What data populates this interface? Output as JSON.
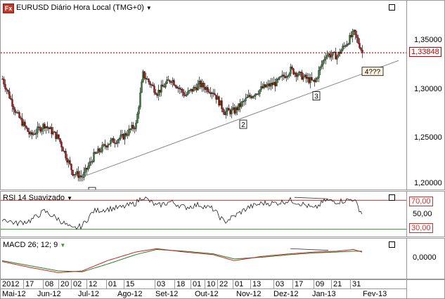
{
  "header": {
    "logo_text": "Fx",
    "title": "EURUSD Diário Hora Local (TMG+0)",
    "dropdown_icon": "triangle-down-icon"
  },
  "price_panel": {
    "current_price_label": "1,33848",
    "y_ticks": [
      "1,35000",
      "1,30000",
      "1,25000",
      "1,20000"
    ],
    "annotations": [
      "1",
      "2",
      "3",
      "4???"
    ]
  },
  "rsi_panel": {
    "title": "RSI 14 Suavizado",
    "levels": [
      "70,00",
      "50,00",
      "30,00"
    ]
  },
  "macd_panel": {
    "title": "MACD 26; 12; 9",
    "y_ticks": [
      "0,0000"
    ]
  },
  "x_axis": {
    "day_labels": [
      "2012",
      "17",
      "08",
      "20",
      "02",
      "12",
      "01",
      "15",
      "03",
      "18",
      "01",
      "10",
      "22",
      "01",
      "13",
      "03",
      "17",
      "09",
      "21",
      "31"
    ],
    "month_labels": [
      "Mai-12",
      "Jun-12",
      "Jul-12",
      "Ago-12",
      "Set-12",
      "Out-12",
      "Nov-12",
      "Dez-12",
      "Jan-13",
      "Fev-13"
    ]
  },
  "colors": {
    "bull": "#2b7a2b",
    "bear": "#b00000",
    "rsi_upper": "#d03030",
    "rsi_lower": "#2a9a2a",
    "price_line": "#c00000",
    "macd_fast": "#cc2020",
    "macd_slow": "#208020"
  },
  "chart_data": {
    "type": "candlestick",
    "price": {
      "ylim": [
        1.19,
        1.38
      ],
      "current": 1.33848,
      "anchors": [
        [
          0,
          1.31
        ],
        [
          10,
          1.272
        ],
        [
          20,
          1.248
        ],
        [
          30,
          1.26
        ],
        [
          40,
          1.245
        ],
        [
          50,
          1.208
        ],
        [
          57,
          1.203
        ],
        [
          65,
          1.226
        ],
        [
          75,
          1.24
        ],
        [
          85,
          1.246
        ],
        [
          95,
          1.26
        ],
        [
          100,
          1.315
        ],
        [
          110,
          1.295
        ],
        [
          120,
          1.31
        ],
        [
          130,
          1.292
        ],
        [
          140,
          1.304
        ],
        [
          150,
          1.296
        ],
        [
          158,
          1.274
        ],
        [
          165,
          1.275
        ],
        [
          175,
          1.29
        ],
        [
          185,
          1.3
        ],
        [
          195,
          1.306
        ],
        [
          205,
          1.32
        ],
        [
          215,
          1.311
        ],
        [
          222,
          1.306
        ],
        [
          230,
          1.337
        ],
        [
          238,
          1.335
        ],
        [
          245,
          1.35
        ],
        [
          250,
          1.36
        ],
        [
          254,
          1.347
        ],
        [
          256,
          1.3385
        ]
      ],
      "count": 257,
      "trendline": {
        "from": [
          57,
          1.203
        ],
        "to": [
          282,
          1.33
        ]
      }
    },
    "rsi": {
      "ylim": [
        20,
        80
      ],
      "levels": [
        70,
        50,
        30
      ],
      "anchors": [
        [
          0,
          45
        ],
        [
          10,
          38
        ],
        [
          20,
          42
        ],
        [
          30,
          55
        ],
        [
          40,
          44
        ],
        [
          50,
          30
        ],
        [
          57,
          35
        ],
        [
          65,
          55
        ],
        [
          75,
          58
        ],
        [
          85,
          60
        ],
        [
          95,
          66
        ],
        [
          100,
          75
        ],
        [
          110,
          62
        ],
        [
          120,
          68
        ],
        [
          130,
          60
        ],
        [
          140,
          64
        ],
        [
          150,
          58
        ],
        [
          158,
          40
        ],
        [
          165,
          48
        ],
        [
          175,
          60
        ],
        [
          185,
          66
        ],
        [
          195,
          66
        ],
        [
          205,
          70
        ],
        [
          215,
          64
        ],
        [
          222,
          58
        ],
        [
          230,
          70
        ],
        [
          238,
          68
        ],
        [
          245,
          70
        ],
        [
          250,
          72
        ],
        [
          254,
          58
        ],
        [
          256,
          52
        ]
      ]
    },
    "macd": {
      "ylim": [
        -0.025,
        0.02
      ],
      "fast": [
        [
          0,
          -0.005
        ],
        [
          20,
          -0.012
        ],
        [
          40,
          -0.018
        ],
        [
          57,
          -0.016
        ],
        [
          75,
          -0.004
        ],
        [
          95,
          0.006
        ],
        [
          110,
          0.01
        ],
        [
          130,
          0.006
        ],
        [
          150,
          0.003
        ],
        [
          165,
          -0.004
        ],
        [
          185,
          0.001
        ],
        [
          205,
          0.004
        ],
        [
          222,
          0.006
        ],
        [
          238,
          0.007
        ],
        [
          250,
          0.009
        ],
        [
          256,
          0.006
        ]
      ],
      "slow": [
        [
          0,
          -0.004
        ],
        [
          20,
          -0.01
        ],
        [
          40,
          -0.016
        ],
        [
          57,
          -0.017
        ],
        [
          75,
          -0.008
        ],
        [
          95,
          0.003
        ],
        [
          110,
          0.009
        ],
        [
          130,
          0.007
        ],
        [
          150,
          0.004
        ],
        [
          165,
          -0.002
        ],
        [
          185,
          0.0
        ],
        [
          205,
          0.003
        ],
        [
          222,
          0.005
        ],
        [
          238,
          0.006
        ],
        [
          250,
          0.007
        ],
        [
          256,
          0.007
        ]
      ]
    }
  }
}
